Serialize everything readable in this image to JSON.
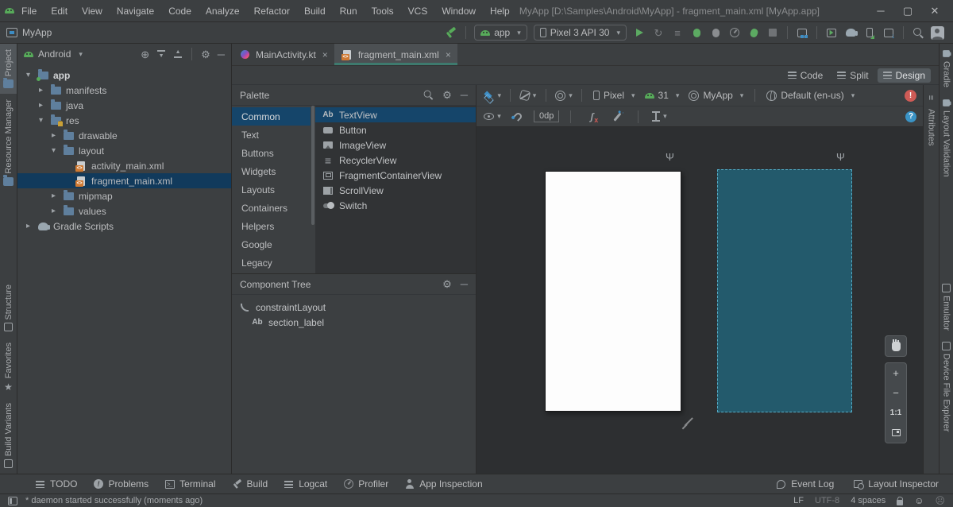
{
  "colors": {
    "panel_bg": "#3c3f41",
    "editor_bg": "#313335",
    "canvas_bg": "#2d2f31",
    "selection_blue": "#15456a",
    "tree_selection": "#113a5c",
    "accent_green": "#57ab5a",
    "blueprint_fill": "#235a6c",
    "blueprint_border": "#55aec8",
    "error_red": "#cf5b56",
    "help_blue": "#3a93c5",
    "active_tab_underline": "#3e7a6e"
  },
  "menubar": {
    "items": [
      {
        "label": "File"
      },
      {
        "label": "Edit"
      },
      {
        "label": "View"
      },
      {
        "label": "Navigate"
      },
      {
        "label": "Code"
      },
      {
        "label": "Analyze"
      },
      {
        "label": "Refactor"
      },
      {
        "label": "Build"
      },
      {
        "label": "Run"
      },
      {
        "label": "Tools"
      },
      {
        "label": "VCS"
      },
      {
        "label": "Window"
      },
      {
        "label": "Help"
      }
    ],
    "title": "MyApp [D:\\Samples\\Android\\MyApp] - fragment_main.xml [MyApp.app]"
  },
  "toolbar": {
    "project": "MyApp",
    "run_config": "app",
    "device": "Pixel 3 API 30"
  },
  "left_stripe": {
    "top": [
      {
        "label": "Project",
        "icon": "project",
        "active": true
      },
      {
        "label": "Resource Manager",
        "icon": "resource-manager"
      }
    ],
    "bottom": [
      {
        "label": "Structure",
        "icon": "structure"
      },
      {
        "label": "Favorites",
        "icon": "favorites"
      },
      {
        "label": "Build Variants",
        "icon": "build-variants"
      }
    ]
  },
  "project_panel": {
    "view": "Android",
    "tree": [
      {
        "label": "app",
        "indent": 0,
        "icon": "folder-app",
        "chev": "down",
        "bold": true
      },
      {
        "label": "manifests",
        "indent": 1,
        "icon": "folder",
        "chev": "right"
      },
      {
        "label": "java",
        "indent": 1,
        "icon": "folder",
        "chev": "right"
      },
      {
        "label": "res",
        "indent": 1,
        "icon": "folder-res",
        "chev": "down"
      },
      {
        "label": "drawable",
        "indent": 2,
        "icon": "folder",
        "chev": "right"
      },
      {
        "label": "layout",
        "indent": 2,
        "icon": "folder",
        "chev": "down"
      },
      {
        "label": "activity_main.xml",
        "indent": 3,
        "icon": "xml",
        "chev": "none"
      },
      {
        "label": "fragment_main.xml",
        "indent": 3,
        "icon": "xml",
        "chev": "none",
        "selected": true
      },
      {
        "label": "mipmap",
        "indent": 2,
        "icon": "folder",
        "chev": "right"
      },
      {
        "label": "values",
        "indent": 2,
        "icon": "folder",
        "chev": "right"
      },
      {
        "label": "Gradle Scripts",
        "indent": 0,
        "icon": "gradle",
        "chev": "right"
      }
    ]
  },
  "editor": {
    "tabs": [
      {
        "label": "MainActivity.kt",
        "icon": "kotlin",
        "active": false
      },
      {
        "label": "fragment_main.xml",
        "icon": "xml",
        "active": true
      }
    ],
    "modes": [
      {
        "label": "Code"
      },
      {
        "label": "Split"
      },
      {
        "label": "Design",
        "active": true
      }
    ]
  },
  "palette": {
    "title": "Palette",
    "categories": [
      {
        "label": "Common",
        "selected": true
      },
      {
        "label": "Text"
      },
      {
        "label": "Buttons"
      },
      {
        "label": "Widgets"
      },
      {
        "label": "Layouts"
      },
      {
        "label": "Containers"
      },
      {
        "label": "Helpers"
      },
      {
        "label": "Google"
      },
      {
        "label": "Legacy"
      }
    ],
    "components": [
      {
        "name": "TextView",
        "icon": "textview",
        "selected": true
      },
      {
        "name": "Button",
        "icon": "button"
      },
      {
        "name": "ImageView",
        "icon": "imageview"
      },
      {
        "name": "RecyclerView",
        "icon": "recyclerview"
      },
      {
        "name": "FragmentContainerView",
        "icon": "fragmentcontainer"
      },
      {
        "name": "ScrollView",
        "icon": "scrollview"
      },
      {
        "name": "Switch",
        "icon": "switch"
      }
    ]
  },
  "component_tree": {
    "title": "Component Tree",
    "items": [
      {
        "label": "constraintLayout",
        "icon": "constraint",
        "indent": 0
      },
      {
        "label": "section_label",
        "icon": "textview",
        "indent": 1
      }
    ]
  },
  "design_toolbar": {
    "device": "Pixel",
    "api_level": "31",
    "theme": "MyApp",
    "locale": "Default (en-us)",
    "margin": "0dp"
  },
  "zoom_controls": {
    "zoom_in": "+",
    "zoom_out": "−",
    "actual": "1:1"
  },
  "attributes_tab": {
    "label": "Attributes"
  },
  "right_stripe": {
    "top": [
      {
        "label": "Gradle",
        "icon": "gradle"
      },
      {
        "label": "Layout Validation",
        "icon": "layout-validation"
      }
    ],
    "bottom": [
      {
        "label": "Emulator",
        "icon": "emulator"
      },
      {
        "label": "Device File Explorer",
        "icon": "device-file-explorer"
      }
    ]
  },
  "bottom_bar": {
    "left": [
      {
        "label": "TODO",
        "icon": "todo"
      },
      {
        "label": "Problems",
        "icon": "problems"
      },
      {
        "label": "Terminal",
        "icon": "terminal"
      },
      {
        "label": "Build",
        "icon": "build"
      },
      {
        "label": "Logcat",
        "icon": "logcat"
      },
      {
        "label": "Profiler",
        "icon": "profiler"
      },
      {
        "label": "App Inspection",
        "icon": "app-inspection"
      }
    ],
    "right": [
      {
        "label": "Event Log",
        "icon": "event-log"
      },
      {
        "label": "Layout Inspector",
        "icon": "layout-inspector"
      }
    ]
  },
  "status_bar": {
    "message": "* daemon started successfully (moments ago)",
    "line_ending": "LF",
    "encoding": "UTF-8",
    "indent": "4 spaces"
  }
}
